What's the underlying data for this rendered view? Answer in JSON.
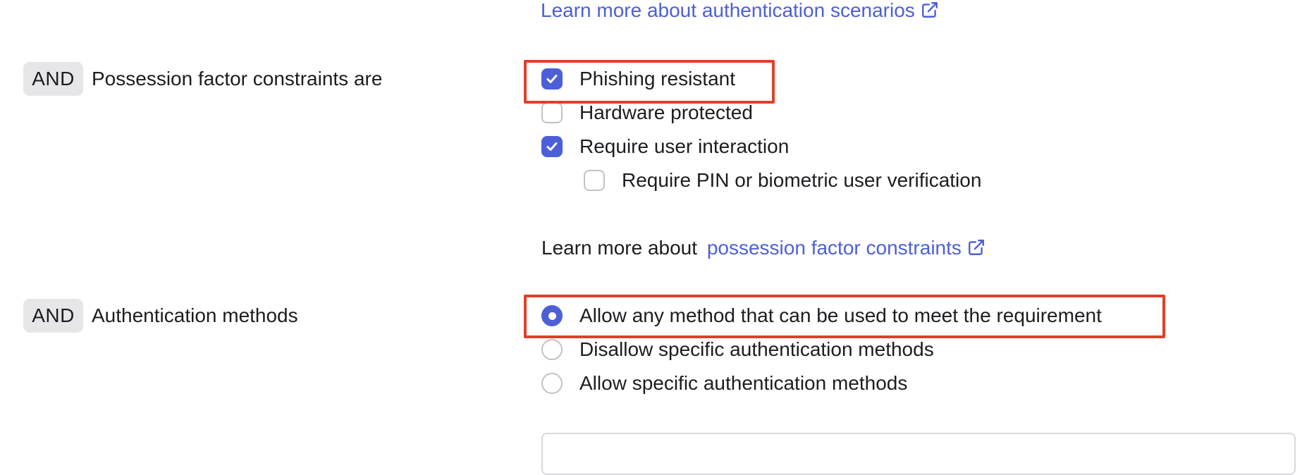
{
  "header_link": {
    "text": "Learn more about authentication scenarios",
    "icon": "external-link-icon"
  },
  "possession": {
    "chip": "AND",
    "label": "Possession factor constraints are",
    "options": [
      {
        "label": "Phishing resistant",
        "checked": true,
        "highlighted": true
      },
      {
        "label": "Hardware protected",
        "checked": false
      },
      {
        "label": "Require user interaction",
        "checked": true
      },
      {
        "label": "Require PIN or biometric user verification",
        "checked": false,
        "nested": true
      }
    ],
    "learn_more_prefix": "Learn more about",
    "learn_more_link": "possession factor constraints"
  },
  "auth_methods": {
    "chip": "AND",
    "label": "Authentication methods",
    "options": [
      {
        "label": "Allow any method that can be used to meet the requirement",
        "selected": true,
        "highlighted": true
      },
      {
        "label": "Disallow specific authentication methods",
        "selected": false
      },
      {
        "label": "Allow specific authentication methods",
        "selected": false
      }
    ]
  },
  "colors": {
    "accent": "#4d5fd6",
    "highlight": "#e13f2a",
    "chip_bg": "#e6e6e8"
  }
}
